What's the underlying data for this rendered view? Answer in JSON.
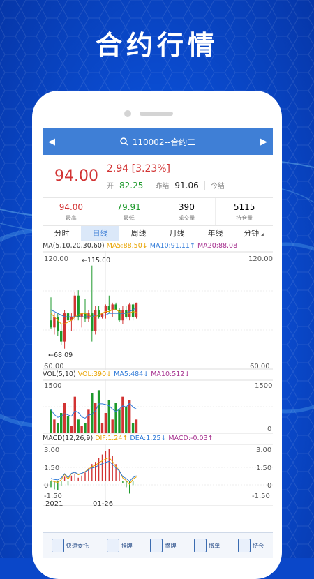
{
  "headline": "合约行情",
  "nav": {
    "title": "110002--合约二"
  },
  "quote": {
    "price": "94.00",
    "change": "2.94 [3.23%]",
    "open_label": "开",
    "open_value": "82.25",
    "prev_close_label": "昨结",
    "prev_close_value": "91.06",
    "settle_label": "今结",
    "settle_value": "--"
  },
  "stats": [
    {
      "value": "94.00",
      "label": "最高",
      "color": "#d23333"
    },
    {
      "value": "79.91",
      "label": "最低",
      "color": "#1e9a2c"
    },
    {
      "value": "390",
      "label": "成交量",
      "color": "#222222"
    },
    {
      "value": "5115",
      "label": "持仓量",
      "color": "#222222"
    }
  ],
  "tabs": [
    "分时",
    "日线",
    "周线",
    "月线",
    "年线",
    "分钟"
  ],
  "active_tab": "日线",
  "ma_legend": {
    "name": "MA(5,10,20,30,60)",
    "ma5": "MA5:88.50↓",
    "ma10": "MA10:91.11↑",
    "ma20": "MA20:88.08"
  },
  "price_chart": {
    "top": "120.00",
    "bottom": "60.00",
    "high_mark": "←115.00",
    "low_mark": "←68.09"
  },
  "vol_legend": {
    "name": "VOL(5,10)",
    "vol": "VOL:390↓",
    "ma5": "MA5:484↓",
    "ma10": "MA10:512↓"
  },
  "vol_chart": {
    "top": "1500",
    "bottom": "0"
  },
  "macd_legend": {
    "name": "MACD(12,26,9)",
    "dif": "DIF:1.24↑",
    "dea": "DEA:1.25↓",
    "macd": "MACD:-0.03↑"
  },
  "macd_chart": {
    "y1": "3.00",
    "y2": "1.50",
    "y3": "0",
    "y4": "-1.50"
  },
  "dates": {
    "start": "2021",
    "mid": "01-26"
  },
  "bottom_buttons": [
    "快速委托",
    "挂牌",
    "摘牌",
    "撤单",
    "持仓"
  ],
  "colors": {
    "up": "#d23333",
    "down": "#1e9a2c",
    "accent": "#3f7fd6",
    "ma5": "#e8a300",
    "ma10": "#2f7ad8",
    "ma20": "#a6318f"
  },
  "chart_data": {
    "type": "candlestick",
    "candles": [
      {
        "o": 84,
        "h": 97,
        "l": 79,
        "c": 80
      },
      {
        "o": 80,
        "h": 88,
        "l": 76,
        "c": 86
      },
      {
        "o": 86,
        "h": 88,
        "l": 75,
        "c": 78
      },
      {
        "o": 78,
        "h": 82,
        "l": 70,
        "c": 72
      },
      {
        "o": 72,
        "h": 90,
        "l": 68,
        "c": 88
      },
      {
        "o": 88,
        "h": 96,
        "l": 82,
        "c": 84
      },
      {
        "o": 84,
        "h": 88,
        "l": 78,
        "c": 86
      },
      {
        "o": 86,
        "h": 100,
        "l": 84,
        "c": 98
      },
      {
        "o": 98,
        "h": 101,
        "l": 84,
        "c": 86
      },
      {
        "o": 86,
        "h": 88,
        "l": 80,
        "c": 88
      },
      {
        "o": 88,
        "h": 96,
        "l": 83,
        "c": 85
      },
      {
        "o": 85,
        "h": 90,
        "l": 83,
        "c": 88
      },
      {
        "o": 88,
        "h": 115,
        "l": 72,
        "c": 78
      },
      {
        "o": 78,
        "h": 92,
        "l": 76,
        "c": 90
      },
      {
        "o": 90,
        "h": 92,
        "l": 85,
        "c": 86
      },
      {
        "o": 86,
        "h": 88,
        "l": 85,
        "c": 88
      },
      {
        "o": 88,
        "h": 93,
        "l": 85,
        "c": 92
      },
      {
        "o": 92,
        "h": 98,
        "l": 88,
        "c": 90
      },
      {
        "o": 90,
        "h": 94,
        "l": 86,
        "c": 93
      },
      {
        "o": 93,
        "h": 94,
        "l": 90,
        "c": 90
      },
      {
        "o": 90,
        "h": 91,
        "l": 83,
        "c": 84
      },
      {
        "o": 84,
        "h": 92,
        "l": 82,
        "c": 90
      },
      {
        "o": 90,
        "h": 92,
        "l": 85,
        "c": 86
      },
      {
        "o": 86,
        "h": 94,
        "l": 84,
        "c": 93
      },
      {
        "o": 93,
        "h": 94,
        "l": 84,
        "c": 86
      },
      {
        "o": 86,
        "h": 94,
        "l": 85,
        "c": 94
      }
    ],
    "volume": [
      700,
      400,
      300,
      600,
      900,
      500,
      200,
      1100,
      400,
      200,
      300,
      700,
      1200,
      900,
      1300,
      300,
      600,
      1000,
      400,
      900,
      700,
      1100,
      800,
      1000,
      300,
      400
    ],
    "macd_bars": [
      -0.6,
      -0.8,
      -0.9,
      -0.5,
      0.4,
      -0.4,
      0.5,
      0.7,
      0.3,
      0.5,
      0.8,
      1.2,
      1.6,
      1.8,
      2.2,
      2.5,
      2.8,
      3.0,
      2.4,
      1.6,
      1.0,
      -0.2,
      -0.6,
      -1.2,
      -0.4,
      -0.03
    ],
    "ma5": [
      88,
      86,
      84,
      82,
      82,
      83,
      84,
      86,
      87,
      88,
      88,
      87,
      86,
      86,
      87,
      88,
      89,
      89,
      90,
      90,
      89,
      88,
      88,
      88,
      89,
      88.5
    ],
    "ma10": [
      90,
      89,
      88,
      87,
      86,
      86,
      86,
      86,
      86,
      86,
      86,
      86,
      86,
      87,
      87,
      87,
      87,
      88,
      88,
      88,
      88,
      88,
      88,
      89,
      90,
      91.1
    ],
    "ylim_price": [
      60,
      120
    ],
    "ylim_vol": [
      0,
      1500
    ],
    "ylim_macd": [
      -1.5,
      3
    ]
  }
}
